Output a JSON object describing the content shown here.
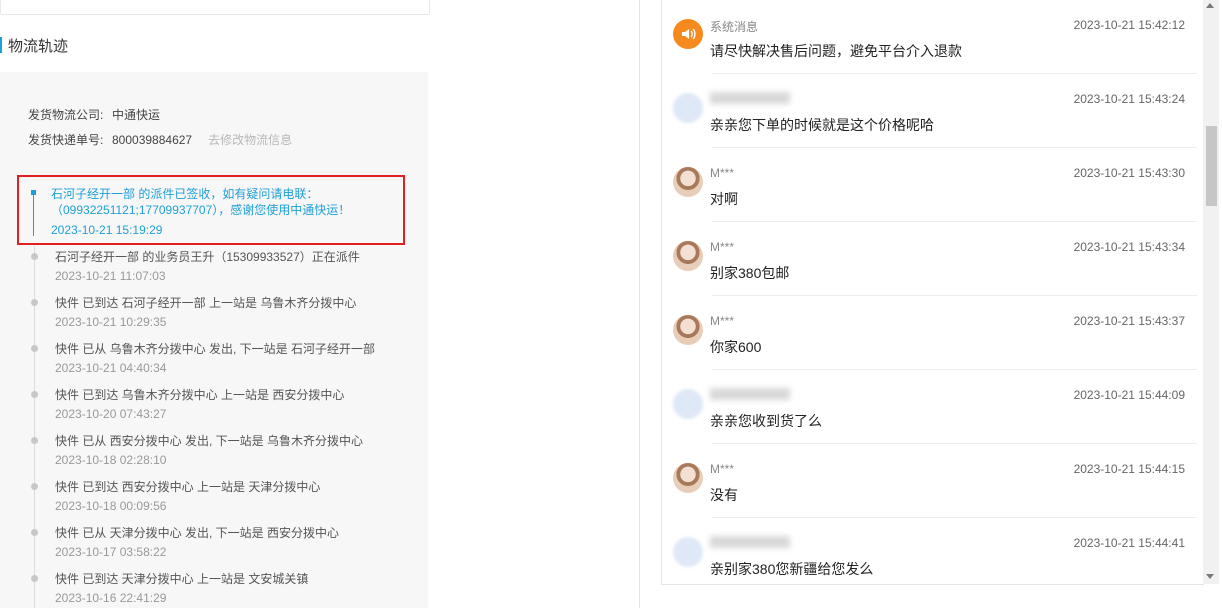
{
  "logistics": {
    "section_title": "物流轨迹",
    "company_label": "发货物流公司:",
    "company_value": "中通快运",
    "tracking_label": "发货快递单号:",
    "tracking_value": "800039884627",
    "edit_link": "去修改物流信息",
    "latest": {
      "text": "石河子经开一部 的派件已签收，如有疑问请电联：（09932251121;17709937707），感谢您使用中通快运！",
      "time": "2023-10-21 15:19:29"
    },
    "events": [
      {
        "text": "石河子经开一部 的业务员王升（15309933527）正在派件",
        "time": "2023-10-21 11:07:03"
      },
      {
        "text": "快件 已到达 石河子经开一部 上一站是 乌鲁木齐分拨中心",
        "time": "2023-10-21 10:29:35"
      },
      {
        "text": "快件 已从 乌鲁木齐分拨中心 发出, 下一站是 石河子经开一部",
        "time": "2023-10-21 04:40:34"
      },
      {
        "text": "快件 已到达 乌鲁木齐分拨中心 上一站是 西安分拨中心",
        "time": "2023-10-20 07:43:27"
      },
      {
        "text": "快件 已从 西安分拨中心 发出, 下一站是 乌鲁木齐分拨中心",
        "time": "2023-10-18 02:28:10"
      },
      {
        "text": "快件 已到达 西安分拨中心 上一站是 天津分拨中心",
        "time": "2023-10-18 00:09:56"
      },
      {
        "text": "快件 已从 天津分拨中心 发出, 下一站是 西安分拨中心",
        "time": "2023-10-17 03:58:22"
      },
      {
        "text": "快件 已到达 天津分拨中心 上一站是 文安城关镇",
        "time": "2023-10-16 22:41:29"
      }
    ],
    "highlight_color": "#1e9fd8",
    "box_color": "#e02020"
  },
  "chat": {
    "messages": [
      {
        "avatar": "speaker-icon",
        "nick": "系统消息",
        "time": "2023-10-21 15:42:12",
        "text": "请尽快解决售后问题，避免平台介入退款"
      },
      {
        "avatar": "blurred",
        "nick": "",
        "time": "2023-10-21 15:43:24",
        "text": "亲亲您下单的时候就是这个价格呢哈"
      },
      {
        "avatar": "user",
        "nick": "M***",
        "time": "2023-10-21 15:43:30",
        "text": "对啊"
      },
      {
        "avatar": "user",
        "nick": "M***",
        "time": "2023-10-21 15:43:34",
        "text": "别家380包邮"
      },
      {
        "avatar": "user",
        "nick": "M***",
        "time": "2023-10-21 15:43:37",
        "text": "你家600"
      },
      {
        "avatar": "blurred",
        "nick": "",
        "time": "2023-10-21 15:44:09",
        "text": "亲亲您收到货了么"
      },
      {
        "avatar": "user",
        "nick": "M***",
        "time": "2023-10-21 15:44:15",
        "text": "没有"
      },
      {
        "avatar": "blurred",
        "nick": "",
        "time": "2023-10-21 15:44:41",
        "text": "亲别家380您新疆给您发么"
      }
    ],
    "system_color": "#f68a1f"
  }
}
